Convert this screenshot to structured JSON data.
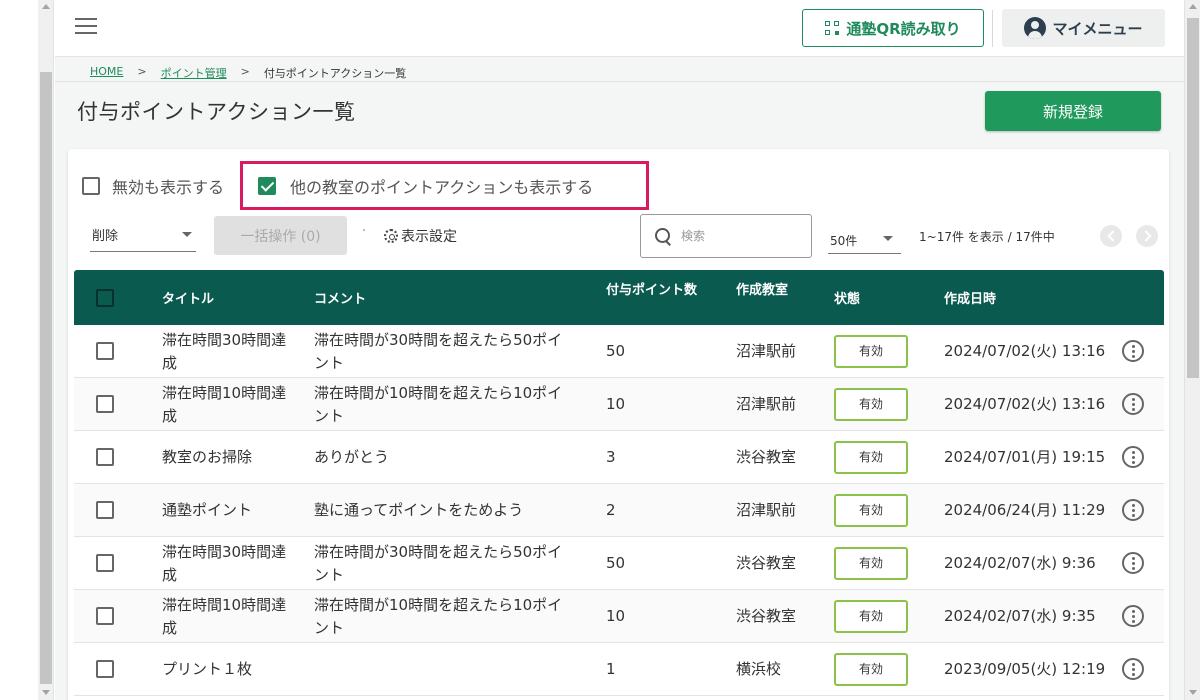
{
  "header": {
    "qr_label": "通塾QR読み取り",
    "mymenu_label": "マイメニュー"
  },
  "breadcrumb": {
    "home": "HOME",
    "sep": ">",
    "point_mgmt": "ポイント管理",
    "current": "付与ポイントアクション一覧"
  },
  "page": {
    "title": "付与ポイントアクション一覧",
    "new_button": "新規登録"
  },
  "filters": {
    "show_disabled": {
      "label": "無効も表示する",
      "checked": false
    },
    "show_other_rooms": {
      "label": "他の教室のポイントアクションも表示する",
      "checked": true
    }
  },
  "toolbar": {
    "bulk_select_value": "削除",
    "bulk_button": "一括操作 (0)",
    "display_settings": "表示設定",
    "search_placeholder": "検索",
    "per_page": "50件",
    "range_text": "1~17件 を表示 / 17件中"
  },
  "colors": {
    "accent": "#1f8a5b",
    "header_bg": "#0a5a50",
    "highlight": "#d81b60",
    "status_border": "#8bc34a"
  },
  "table": {
    "headers": {
      "title": "タイトル",
      "comment": "コメント",
      "points": "付与ポイント数",
      "room": "作成教室",
      "status": "状態",
      "created": "作成日時"
    },
    "rows": [
      {
        "title": "滞在時間30時間達成",
        "comment": "滞在時間が30時間を超えたら50ポイント",
        "points": "50",
        "room": "沼津駅前",
        "status": "有効",
        "created": "2024/07/02(火) 13:16"
      },
      {
        "title": "滞在時間10時間達成",
        "comment": "滞在時間が10時間を超えたら10ポイント",
        "points": "10",
        "room": "沼津駅前",
        "status": "有効",
        "created": "2024/07/02(火) 13:16"
      },
      {
        "title": "教室のお掃除",
        "comment": "ありがとう",
        "points": "3",
        "room": "渋谷教室",
        "status": "有効",
        "created": "2024/07/01(月) 19:15"
      },
      {
        "title": "通塾ポイント",
        "comment": "塾に通ってポイントをためよう",
        "points": "2",
        "room": "沼津駅前",
        "status": "有効",
        "created": "2024/06/24(月) 11:29"
      },
      {
        "title": "滞在時間30時間達成",
        "comment": "滞在時間が30時間を超えたら50ポイント",
        "points": "50",
        "room": "渋谷教室",
        "status": "有効",
        "created": "2024/02/07(水) 9:36"
      },
      {
        "title": "滞在時間10時間達成",
        "comment": "滞在時間が10時間を超えたら10ポイント",
        "points": "10",
        "room": "渋谷教室",
        "status": "有効",
        "created": "2024/02/07(水) 9:35"
      },
      {
        "title": "プリント１枚",
        "comment": "",
        "points": "1",
        "room": "横浜校",
        "status": "有効",
        "created": "2023/09/05(火) 12:19"
      }
    ]
  }
}
